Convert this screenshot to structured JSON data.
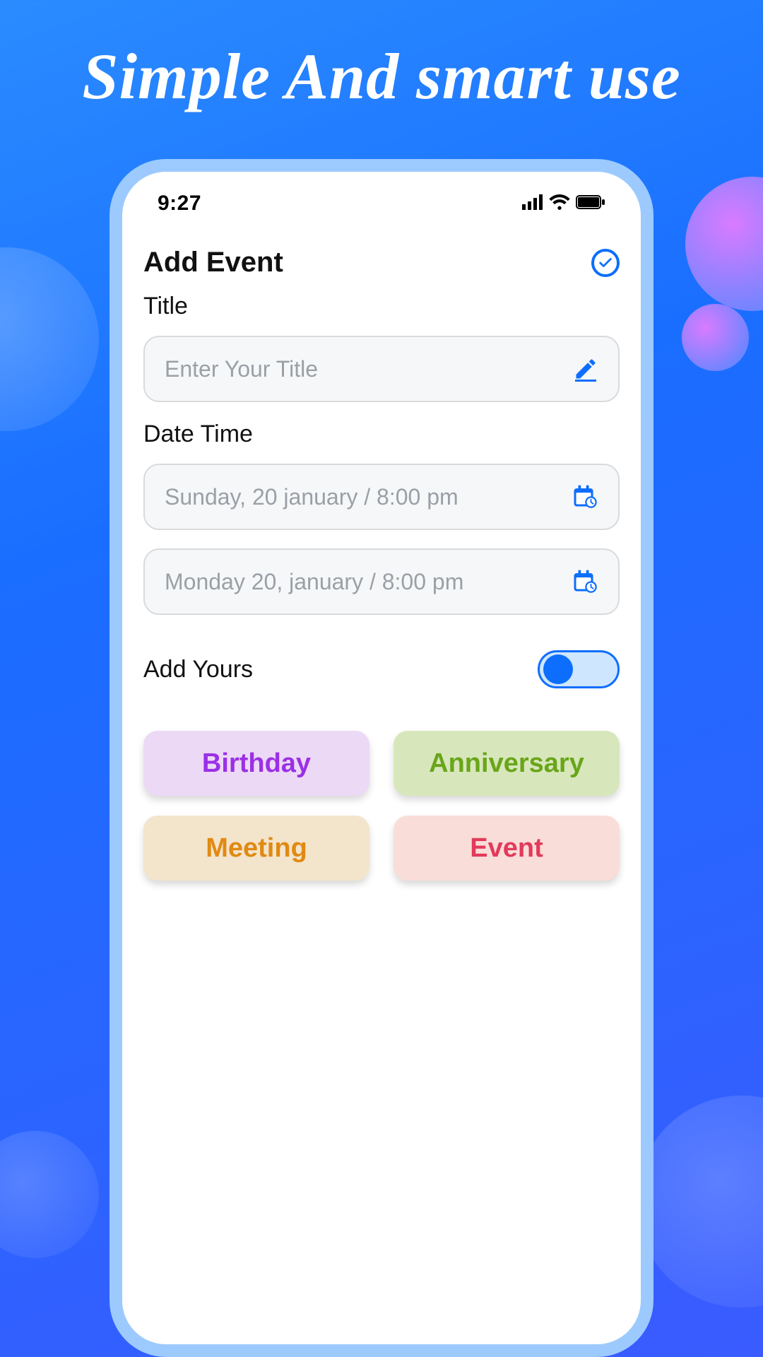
{
  "hero": {
    "title": "Simple And smart use"
  },
  "status": {
    "time": "9:27"
  },
  "header": {
    "title": "Add Event"
  },
  "fields": {
    "title_label": "Title",
    "title_placeholder": "Enter Your Title",
    "datetime_label": "Date Time",
    "start_value": "Sunday,  20 january / 8:00 pm",
    "end_value": "Monday 20, january / 8:00 pm"
  },
  "toggle": {
    "label": "Add Yours",
    "on": true
  },
  "categories": {
    "birthday": "Birthday",
    "anniversary": "Anniversary",
    "meeting": "Meeting",
    "event": "Event"
  },
  "colors": {
    "primary": "#0d6efd",
    "bg_gradient_from": "#2a8bff",
    "bg_gradient_to": "#3a5bff"
  }
}
